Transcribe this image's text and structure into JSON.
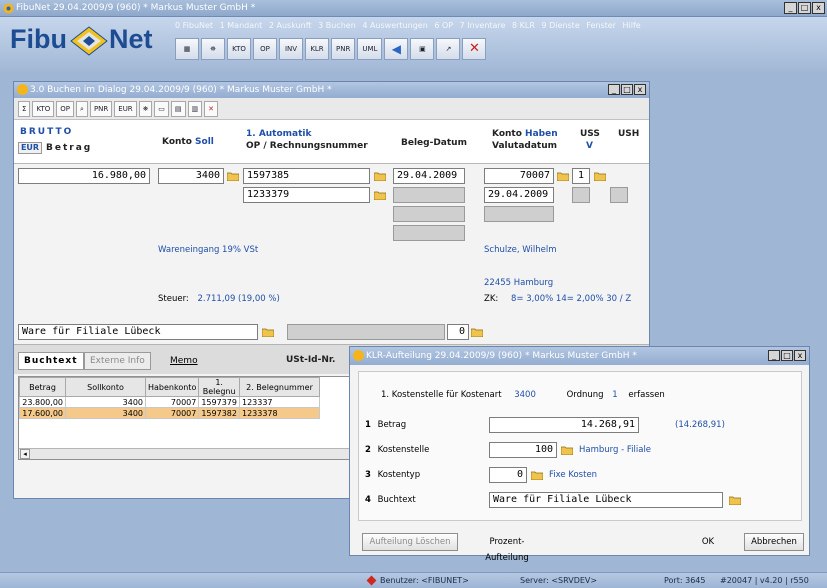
{
  "app": {
    "title": "FibuNet 29.04.2009/9 (960) * Markus Muster GmbH *",
    "logo_left": "Fibu",
    "logo_right": "Net",
    "menu": [
      "0 FibuNet",
      "1 Mandant",
      "2 Auskunft",
      "3 Buchen",
      "4 Auswertungen",
      "6 OP",
      "7 Inventare",
      "8 KLR",
      "9 Dienste",
      "Fenster",
      "Hilfe"
    ],
    "toolbar": [
      "KTO",
      "OP",
      "INV",
      "KLR",
      "PNR",
      "UML"
    ]
  },
  "buchen": {
    "title": "3.0 Buchen im Dialog 29.04.2009/9 (960) * Markus Muster GmbH *",
    "toolbar": [
      "Σ",
      "KTO",
      "OP",
      "PNR",
      "EUR"
    ],
    "headers": {
      "brutto": "BRUTTO",
      "eur": "EUR",
      "betrag": "Betrag",
      "konto": "Konto",
      "soll": "Soll",
      "automatik": "1. Automatik",
      "op": "OP / Rechnungsnummer",
      "belegdatum": "Beleg-Datum",
      "konto_haben_1": "Konto",
      "haben": "Haben",
      "valutadatum": "Valutadatum",
      "uss": "USS",
      "uss_v": "V",
      "ush": "USH"
    },
    "betrag": "16.980,00",
    "konto_soll": "3400",
    "op_nr1": "1597385",
    "op_nr2": "1233379",
    "beleg_datum": "29.04.2009",
    "konto_haben": "70007",
    "uss_value": "1",
    "valuta_datum": "29.04.2009",
    "info_left": "Wareneingang 19% VSt",
    "info_right_name": "Schulze, Wilhelm",
    "info_right_city": "22455 Hamburg",
    "steuer_label": "Steuer:",
    "steuer_value": "2.711,09 (19,00 %)",
    "zk_label": "ZK:",
    "zk_value": "8= 3,00% 14= 2,00% 30 / Z",
    "buchtext": "Ware für Filiale Lübeck",
    "code_value": "0",
    "tabs": {
      "buchtext": "Buchtext",
      "externe": "Externe Info",
      "memo": "Memo"
    },
    "ust_label": "USt-Id-Nr.",
    "grid": {
      "columns": [
        "Betrag",
        "Sollkonto",
        "Habenkonto",
        "1. Belegnu",
        "2. Belegnummer"
      ],
      "rows": [
        [
          "23.800,00",
          "3400",
          "70007",
          "1597379",
          "123337"
        ],
        [
          "17.600,00",
          "3400",
          "70007",
          "1597382",
          "1233378"
        ]
      ]
    }
  },
  "klr": {
    "title": "KLR-Aufteilung 29.04.2009/9 (960) * Markus Muster GmbH *",
    "kostenstelle_label": "1. Kostenstelle für Kostenart",
    "kostenart": "3400",
    "ordnung_label": "Ordnung",
    "ordnung_value": "1",
    "erfassen": "erfassen",
    "rows": {
      "betrag": {
        "num": "1",
        "label": "Betrag",
        "value": "14.268,91",
        "extra": "(14.268,91)"
      },
      "kostenstelle": {
        "num": "2",
        "label": "Kostenstelle",
        "value": "100",
        "extra": "Hamburg - Filiale"
      },
      "kostentyp": {
        "num": "3",
        "label": "Kostentyp",
        "value": "0",
        "extra": "Fixe Kosten"
      },
      "buchtext": {
        "num": "4",
        "label": "Buchtext",
        "value": "Ware für Filiale Lübeck"
      }
    },
    "buttons": {
      "loeschen": "Aufteilung Löschen",
      "prozent": "Prozent-Aufteilung",
      "ok": "OK",
      "abbrechen": "Abbrechen"
    }
  },
  "status": {
    "benutzer": "Benutzer: <FIBUNET>",
    "server": "Server: <SRVDEV>",
    "port": "Port: 3645",
    "version": "#20047 | v4.20 | r550"
  }
}
